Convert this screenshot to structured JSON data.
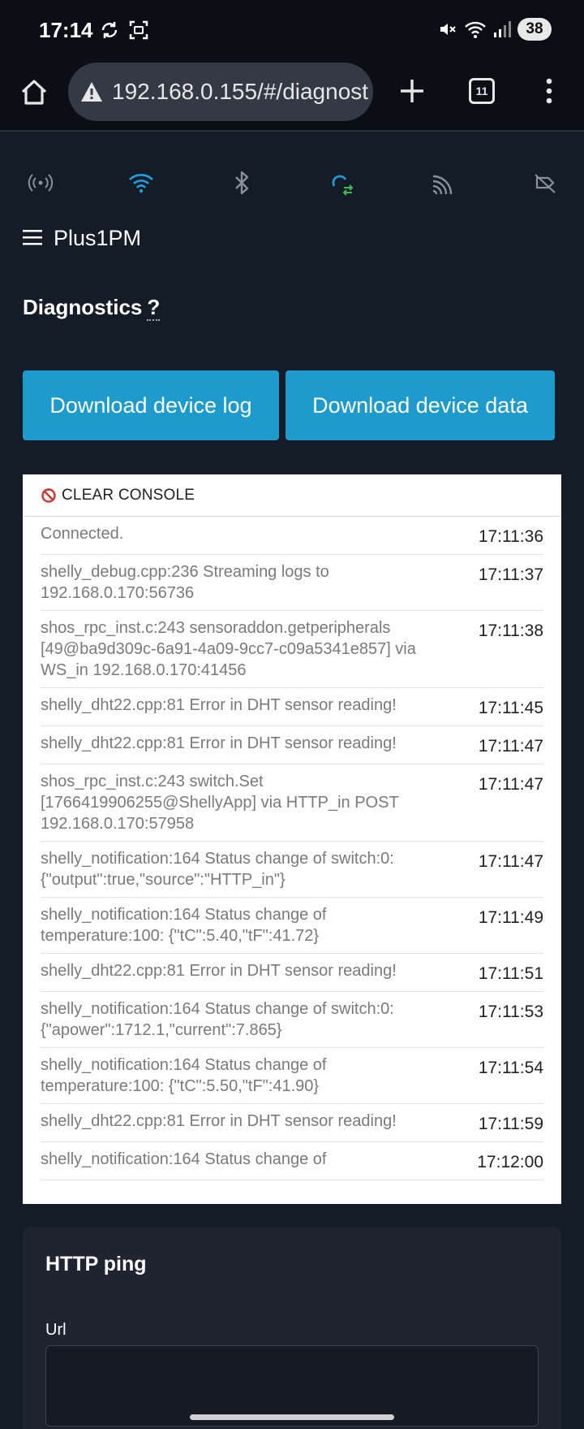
{
  "statusbar": {
    "time": "17:14",
    "battery": "38"
  },
  "browser": {
    "url": "192.168.0.155/#/diagnost",
    "tab_count": "11"
  },
  "header": {
    "device_name": "Plus1PM"
  },
  "page": {
    "title": "Diagnostics",
    "help": "?"
  },
  "buttons": {
    "download_log": "Download device log",
    "download_data": "Download device data"
  },
  "console": {
    "clear_label": "CLEAR CONSOLE",
    "logs": [
      {
        "msg": "Connected.",
        "time": "17:11:36"
      },
      {
        "msg": "shelly_debug.cpp:236    Streaming logs to 192.168.0.170:56736",
        "time": "17:11:37"
      },
      {
        "msg": "shos_rpc_inst.c:243 sensoraddon.getperipherals [49@ba9d309c-6a91-4a09-9cc7-c09a5341e857] via WS_in 192.168.0.170:41456",
        "time": "17:11:38"
      },
      {
        "msg": "shelly_dht22.cpp:81     Error in DHT sensor reading!",
        "time": "17:11:45"
      },
      {
        "msg": "shelly_dht22.cpp:81     Error in DHT sensor reading!",
        "time": "17:11:47"
      },
      {
        "msg": "shos_rpc_inst.c:243    switch.Set [1766419906255@ShellyApp] via HTTP_in POST 192.168.0.170:57958",
        "time": "17:11:47"
      },
      {
        "msg": "shelly_notification:164 Status change of switch:0: {\"output\":true,\"source\":\"HTTP_in\"}",
        "time": "17:11:47"
      },
      {
        "msg": "shelly_notification:164 Status change of temperature:100: {\"tC\":5.40,\"tF\":41.72}",
        "time": "17:11:49"
      },
      {
        "msg": "shelly_dht22.cpp:81     Error in DHT sensor reading!",
        "time": "17:11:51"
      },
      {
        "msg": "shelly_notification:164 Status change of switch:0: {\"apower\":1712.1,\"current\":7.865}",
        "time": "17:11:53"
      },
      {
        "msg": "shelly_notification:164 Status change of temperature:100: {\"tC\":5.50,\"tF\":41.90}",
        "time": "17:11:54"
      },
      {
        "msg": "shelly_dht22.cpp:81     Error in DHT sensor reading!",
        "time": "17:11:59"
      },
      {
        "msg": "shelly_notification:164 Status change of",
        "time": "17:12:00"
      }
    ]
  },
  "ping": {
    "title": "HTTP ping",
    "url_label": "Url",
    "url_value": ""
  },
  "colors": {
    "accent": "#1d9bcc",
    "wifi": "#1da1e0",
    "cloud": "#1da1e0",
    "cloud_arrows": "#3fb950"
  }
}
